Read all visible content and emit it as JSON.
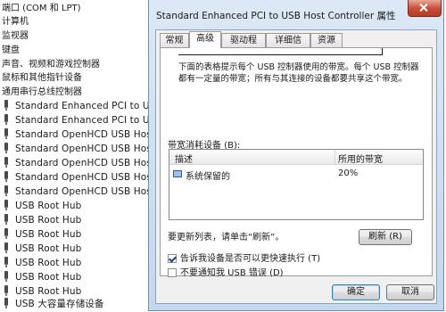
{
  "tree": {
    "categories": [
      "端口 (COM 和 LPT)",
      "计算机",
      "监视器",
      "键盘",
      "声音、视频和游戏控制器",
      "鼠标和其他指针设备",
      "通用串行总线控制器"
    ],
    "usb_items": [
      "Standard Enhanced PCI to USB Hos",
      "Standard Enhanced PCI to USB Hos",
      "Standard OpenHCD USB Host Contro",
      "Standard OpenHCD USB Host Contro",
      "Standard OpenHCD USB Host Contro",
      "Standard OpenHCD USB Host Contro",
      "Standard OpenHCD USB Host Contro",
      "USB Root Hub",
      "USB Root Hub",
      "USB Root Hub",
      "USB Root Hub",
      "USB Root Hub",
      "USB Root Hub",
      "USB Root Hub",
      "USB 大容量存储设备"
    ]
  },
  "dialog": {
    "title": "Standard Enhanced PCI to USB Host Controller 属性",
    "tabs": [
      "常规",
      "高级",
      "驱动程序",
      "详细信息",
      "资源"
    ],
    "active_tab": "高级",
    "description": "下面的表格提示每个 USB 控制器使用的带宽。每个 USB 控制器都有一定量的带宽；所有与其连接的设备都要共享这个带宽。",
    "bandwidth_label": "带宽消耗设备 (B):",
    "table": {
      "columns": [
        "描述",
        "所用的带宽"
      ],
      "rows": [
        {
          "name": "系统保留的",
          "bandwidth": "20%"
        }
      ]
    },
    "refresh_note": "要更新列表，请单击“刷新”。",
    "refresh_button": "刷新 (R)",
    "options": [
      {
        "label": "告诉我设备是否可以更快速执行 (T)",
        "checked": true
      },
      {
        "label": "不要通知我 USB 错误 (D)",
        "checked": false
      }
    ],
    "ok_button": "确定",
    "cancel_button": "取消"
  }
}
